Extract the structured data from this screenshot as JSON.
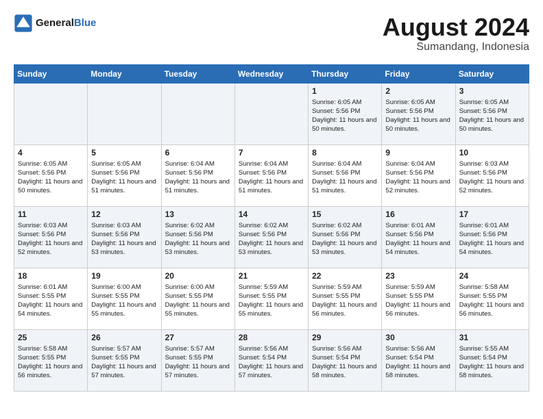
{
  "header": {
    "logo_line1": "General",
    "logo_line2": "Blue",
    "title": "August 2024",
    "subtitle": "Sumandang, Indonesia"
  },
  "days_of_week": [
    "Sunday",
    "Monday",
    "Tuesday",
    "Wednesday",
    "Thursday",
    "Friday",
    "Saturday"
  ],
  "weeks": [
    [
      {
        "day": "",
        "sunrise": "",
        "sunset": "",
        "daylight": ""
      },
      {
        "day": "",
        "sunrise": "",
        "sunset": "",
        "daylight": ""
      },
      {
        "day": "",
        "sunrise": "",
        "sunset": "",
        "daylight": ""
      },
      {
        "day": "",
        "sunrise": "",
        "sunset": "",
        "daylight": ""
      },
      {
        "day": "1",
        "sunrise": "Sunrise: 6:05 AM",
        "sunset": "Sunset: 5:56 PM",
        "daylight": "Daylight: 11 hours and 50 minutes."
      },
      {
        "day": "2",
        "sunrise": "Sunrise: 6:05 AM",
        "sunset": "Sunset: 5:56 PM",
        "daylight": "Daylight: 11 hours and 50 minutes."
      },
      {
        "day": "3",
        "sunrise": "Sunrise: 6:05 AM",
        "sunset": "Sunset: 5:56 PM",
        "daylight": "Daylight: 11 hours and 50 minutes."
      }
    ],
    [
      {
        "day": "4",
        "sunrise": "Sunrise: 6:05 AM",
        "sunset": "Sunset: 5:56 PM",
        "daylight": "Daylight: 11 hours and 50 minutes."
      },
      {
        "day": "5",
        "sunrise": "Sunrise: 6:05 AM",
        "sunset": "Sunset: 5:56 PM",
        "daylight": "Daylight: 11 hours and 51 minutes."
      },
      {
        "day": "6",
        "sunrise": "Sunrise: 6:04 AM",
        "sunset": "Sunset: 5:56 PM",
        "daylight": "Daylight: 11 hours and 51 minutes."
      },
      {
        "day": "7",
        "sunrise": "Sunrise: 6:04 AM",
        "sunset": "Sunset: 5:56 PM",
        "daylight": "Daylight: 11 hours and 51 minutes."
      },
      {
        "day": "8",
        "sunrise": "Sunrise: 6:04 AM",
        "sunset": "Sunset: 5:56 PM",
        "daylight": "Daylight: 11 hours and 51 minutes."
      },
      {
        "day": "9",
        "sunrise": "Sunrise: 6:04 AM",
        "sunset": "Sunset: 5:56 PM",
        "daylight": "Daylight: 11 hours and 52 minutes."
      },
      {
        "day": "10",
        "sunrise": "Sunrise: 6:03 AM",
        "sunset": "Sunset: 5:56 PM",
        "daylight": "Daylight: 11 hours and 52 minutes."
      }
    ],
    [
      {
        "day": "11",
        "sunrise": "Sunrise: 6:03 AM",
        "sunset": "Sunset: 5:56 PM",
        "daylight": "Daylight: 11 hours and 52 minutes."
      },
      {
        "day": "12",
        "sunrise": "Sunrise: 6:03 AM",
        "sunset": "Sunset: 5:56 PM",
        "daylight": "Daylight: 11 hours and 53 minutes."
      },
      {
        "day": "13",
        "sunrise": "Sunrise: 6:02 AM",
        "sunset": "Sunset: 5:56 PM",
        "daylight": "Daylight: 11 hours and 53 minutes."
      },
      {
        "day": "14",
        "sunrise": "Sunrise: 6:02 AM",
        "sunset": "Sunset: 5:56 PM",
        "daylight": "Daylight: 11 hours and 53 minutes."
      },
      {
        "day": "15",
        "sunrise": "Sunrise: 6:02 AM",
        "sunset": "Sunset: 5:56 PM",
        "daylight": "Daylight: 11 hours and 53 minutes."
      },
      {
        "day": "16",
        "sunrise": "Sunrise: 6:01 AM",
        "sunset": "Sunset: 5:56 PM",
        "daylight": "Daylight: 11 hours and 54 minutes."
      },
      {
        "day": "17",
        "sunrise": "Sunrise: 6:01 AM",
        "sunset": "Sunset: 5:56 PM",
        "daylight": "Daylight: 11 hours and 54 minutes."
      }
    ],
    [
      {
        "day": "18",
        "sunrise": "Sunrise: 6:01 AM",
        "sunset": "Sunset: 5:55 PM",
        "daylight": "Daylight: 11 hours and 54 minutes."
      },
      {
        "day": "19",
        "sunrise": "Sunrise: 6:00 AM",
        "sunset": "Sunset: 5:55 PM",
        "daylight": "Daylight: 11 hours and 55 minutes."
      },
      {
        "day": "20",
        "sunrise": "Sunrise: 6:00 AM",
        "sunset": "Sunset: 5:55 PM",
        "daylight": "Daylight: 11 hours and 55 minutes."
      },
      {
        "day": "21",
        "sunrise": "Sunrise: 5:59 AM",
        "sunset": "Sunset: 5:55 PM",
        "daylight": "Daylight: 11 hours and 55 minutes."
      },
      {
        "day": "22",
        "sunrise": "Sunrise: 5:59 AM",
        "sunset": "Sunset: 5:55 PM",
        "daylight": "Daylight: 11 hours and 56 minutes."
      },
      {
        "day": "23",
        "sunrise": "Sunrise: 5:59 AM",
        "sunset": "Sunset: 5:55 PM",
        "daylight": "Daylight: 11 hours and 56 minutes."
      },
      {
        "day": "24",
        "sunrise": "Sunrise: 5:58 AM",
        "sunset": "Sunset: 5:55 PM",
        "daylight": "Daylight: 11 hours and 56 minutes."
      }
    ],
    [
      {
        "day": "25",
        "sunrise": "Sunrise: 5:58 AM",
        "sunset": "Sunset: 5:55 PM",
        "daylight": "Daylight: 11 hours and 56 minutes."
      },
      {
        "day": "26",
        "sunrise": "Sunrise: 5:57 AM",
        "sunset": "Sunset: 5:55 PM",
        "daylight": "Daylight: 11 hours and 57 minutes."
      },
      {
        "day": "27",
        "sunrise": "Sunrise: 5:57 AM",
        "sunset": "Sunset: 5:55 PM",
        "daylight": "Daylight: 11 hours and 57 minutes."
      },
      {
        "day": "28",
        "sunrise": "Sunrise: 5:56 AM",
        "sunset": "Sunset: 5:54 PM",
        "daylight": "Daylight: 11 hours and 57 minutes."
      },
      {
        "day": "29",
        "sunrise": "Sunrise: 5:56 AM",
        "sunset": "Sunset: 5:54 PM",
        "daylight": "Daylight: 11 hours and 58 minutes."
      },
      {
        "day": "30",
        "sunrise": "Sunrise: 5:56 AM",
        "sunset": "Sunset: 5:54 PM",
        "daylight": "Daylight: 11 hours and 58 minutes."
      },
      {
        "day": "31",
        "sunrise": "Sunrise: 5:55 AM",
        "sunset": "Sunset: 5:54 PM",
        "daylight": "Daylight: 11 hours and 58 minutes."
      }
    ]
  ]
}
